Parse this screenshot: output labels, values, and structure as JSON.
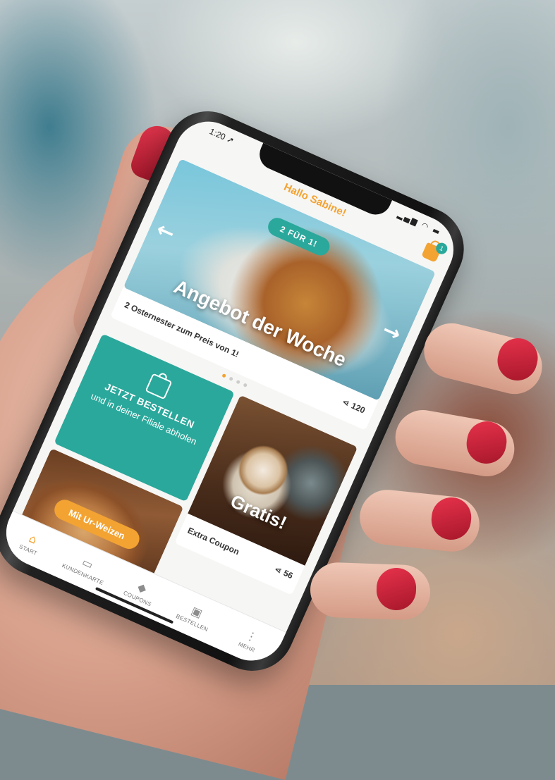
{
  "status_bar": {
    "time": "1:20",
    "time_arrow": "➚",
    "icons": "▂▄▆ ◠ ▬"
  },
  "header": {
    "greeting": "Hallo Sabine!",
    "cart_count": "1",
    "cart_icon": "shopping-bag-icon"
  },
  "hero": {
    "badge": "2 FÜR 1!",
    "title": "Angebot der Woche",
    "subtitle": "2 Osternester zum Preis von 1!",
    "share_icon": "share-icon",
    "share_count": "120",
    "prev_arrow": "←",
    "next_arrow": "→",
    "slide_count": 4,
    "active_slide": 1
  },
  "order_tile": {
    "heading": "JETZT BESTELLEN",
    "subtext": "und in deiner Filiale abholen",
    "icon": "shopping-bag-icon"
  },
  "coupon_tile": {
    "title": "Gratis!",
    "label": "Extra Coupon",
    "share_count": "56"
  },
  "bread_tile": {
    "badge": "Mit Ur-Weizen"
  },
  "tabbar": {
    "items": [
      {
        "label": "START",
        "icon": "home-icon",
        "glyph": "⌂",
        "active": true
      },
      {
        "label": "KUNDENKARTE",
        "icon": "card-icon",
        "glyph": "▭",
        "active": false
      },
      {
        "label": "COUPONS",
        "icon": "tag-icon",
        "glyph": "◆",
        "active": false
      },
      {
        "label": "BESTELLEN",
        "icon": "shopping-bag-icon",
        "glyph": "▣",
        "active": false
      },
      {
        "label": "MEHR",
        "icon": "more-icon",
        "glyph": "⋮",
        "active": false
      }
    ]
  },
  "colors": {
    "accent_orange": "#f3a332",
    "accent_teal": "#2aa89b",
    "nail_red": "#c8223a"
  }
}
